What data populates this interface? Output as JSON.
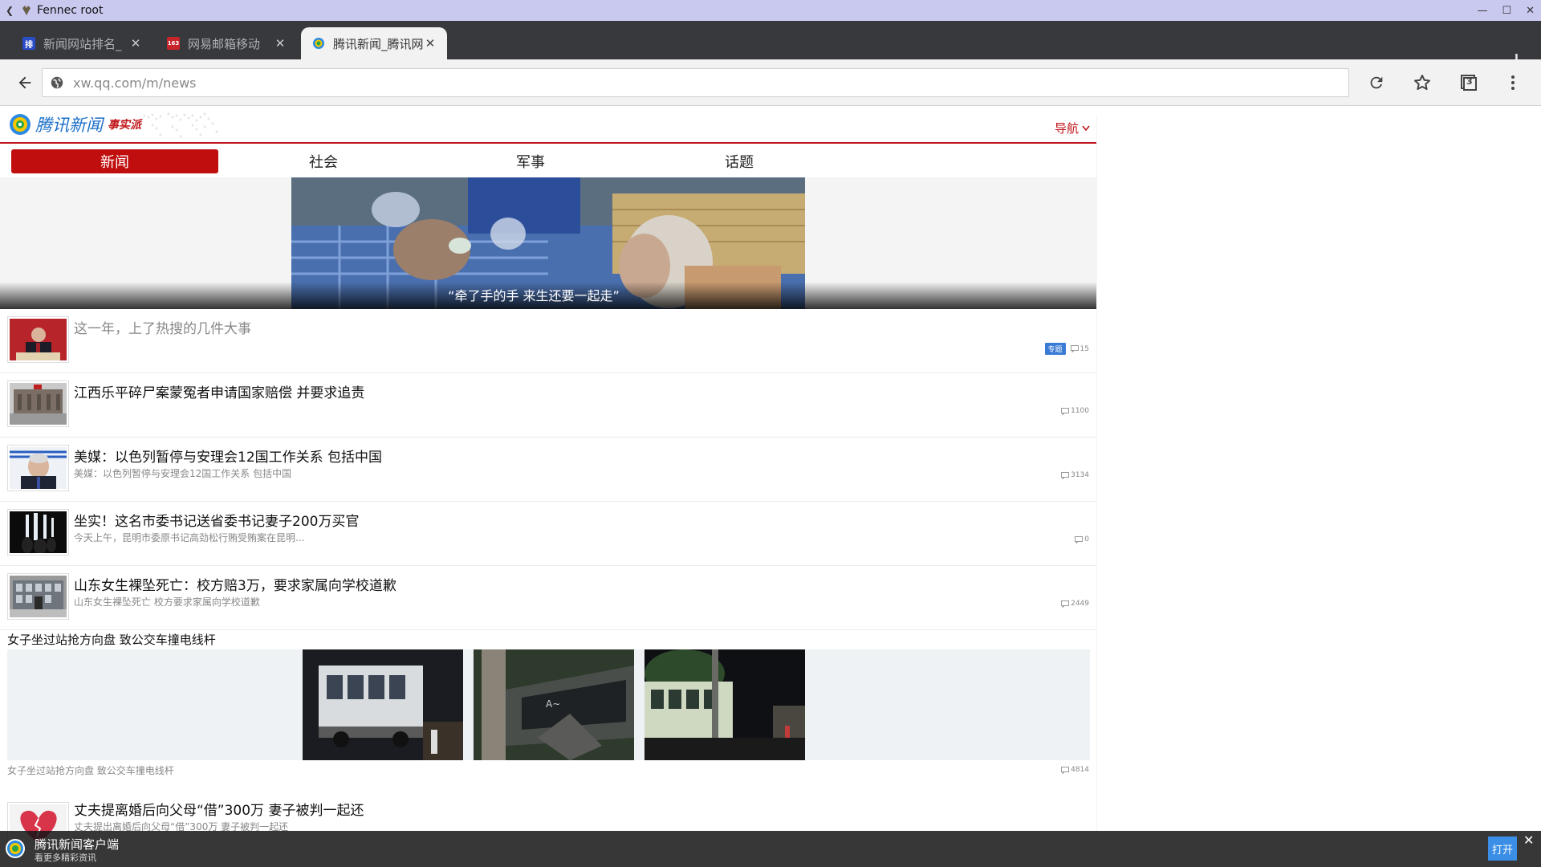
{
  "window": {
    "title": "Fennec root"
  },
  "tabs": [
    {
      "label": "新闻网站排名_",
      "favicon": "排",
      "favicon_color": "#2b4cc7"
    },
    {
      "label": "网易邮箱移动",
      "favicon": "163",
      "favicon_color": "#c8242b"
    },
    {
      "label": "腾讯新闻_腾讯网",
      "favicon": "",
      "favicon_color": "#ffffff"
    }
  ],
  "toolbar": {
    "url": "xw.qq.com/m/news",
    "tab_count": "3"
  },
  "site": {
    "brand": "腾讯新闻",
    "brand_tag": "事实派",
    "nav_label": "导航",
    "accent_color": "#c0161b",
    "channels": [
      "新闻",
      "社会",
      "军事",
      "话题"
    ],
    "hero_caption": "“牵了手的手 来生还要一起走”"
  },
  "news": [
    {
      "title": "这一年，上了热搜的几件大事",
      "subtitle": "",
      "badge": "专题",
      "comments": "15",
      "muted": true
    },
    {
      "title": "江西乐平碎尸案蒙冤者申请国家赔偿 并要求追责",
      "subtitle": "",
      "badge": "",
      "comments": "1100"
    },
    {
      "title": "美媒：以色列暂停与安理会12国工作关系 包括中国",
      "subtitle": "美媒：以色列暂停与安理会12国工作关系 包括中国",
      "badge": "",
      "comments": "3134"
    },
    {
      "title": "坐实！这名市委书记送省委书记妻子200万买官",
      "subtitle": "今天上午，昆明市委原书记高劲松行贿受贿案在昆明...",
      "badge": "",
      "comments": "0"
    },
    {
      "title": "山东女生裸坠死亡：校方赔3万，要求家属向学校道歉",
      "subtitle": "山东女生裸坠死亡 校方要求家属向学校道歉",
      "badge": "",
      "comments": "2449"
    }
  ],
  "gallery": {
    "title": "女子坐过站抢方向盘 致公交车撞电线杆",
    "subtitle": "女子坐过站抢方向盘 致公交车撞电线杆",
    "comments": "4814"
  },
  "last_news": {
    "title": "丈夫提离婚后向父母“借”300万 妻子被判一起还",
    "subtitle": "丈夫提出离婚后向父母“借”300万 妻子被判一起还"
  },
  "banner": {
    "line1": "腾讯新闻客户端",
    "line2": "看更多精彩资讯",
    "open_label": "打开"
  }
}
